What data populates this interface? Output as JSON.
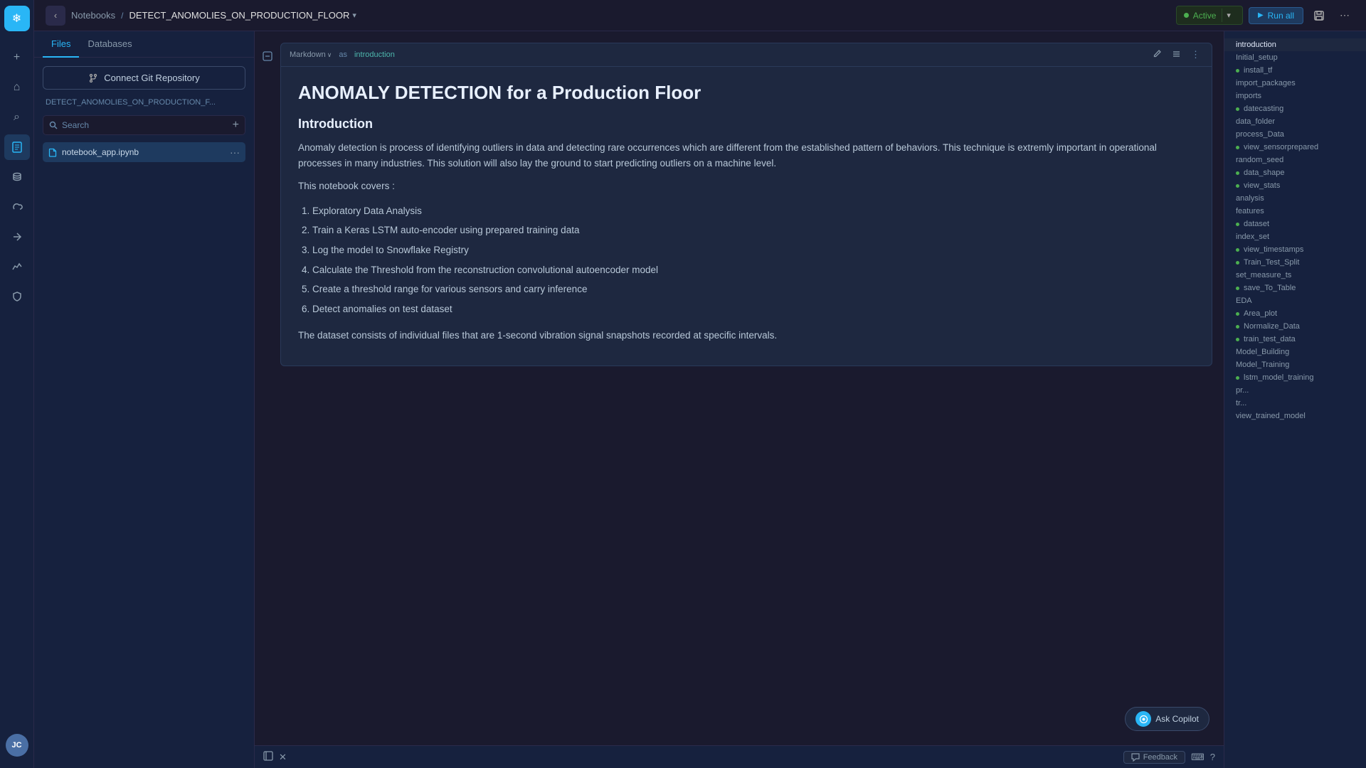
{
  "app": {
    "logo_initials": "❄",
    "title": "DETECT_ANOMOLIES_ON_PRODUCTION_FLOOR",
    "breadcrumb": "Notebooks",
    "title_dropdown": "▾"
  },
  "topbar": {
    "back_label": "‹",
    "status": "Active",
    "status_chevron": "▾",
    "run_all": "Run all",
    "save_icon": "💾",
    "more_icon": "⋯"
  },
  "file_panel": {
    "tabs": [
      "Files",
      "Databases"
    ],
    "active_tab": "Files",
    "connect_git": "Connect Git Repository",
    "notebook_label": "DETECT_ANOMOLIES_ON_PRODUCTION_F...",
    "search_placeholder": "Search",
    "add_icon": "+",
    "file_name": "notebook_app.ipynb",
    "file_dots": "···"
  },
  "cell": {
    "type": "Markdown",
    "type_chevron": "∨",
    "as_label": "as",
    "cell_name": "introduction",
    "edit_icon": "✏",
    "list_icon": "☰",
    "more_icon": "⋮"
  },
  "content": {
    "heading": "ANOMALY DETECTION for a Production Floor",
    "intro_heading": "Introduction",
    "intro_body": "Anomaly detection is process of identifying outliers in data and detecting rare occurrences which are different from the established pattern of behaviors. This technique is extremly important in operational processes in many industries. This solution will also lay the ground to start predicting outliers on a machine level.",
    "covers_label": "This notebook covers :",
    "list_items": [
      "Exploratory Data Analysis",
      "Train a Keras LSTM auto-encoder using prepared training data",
      "Log the model to Snowflake Registry",
      "Calculate the Threshold from the reconstruction convolutional autoencoder model",
      "Create a threshold range for various sensors and carry inference",
      "Detect anomalies on test dataset"
    ],
    "footer_text": "The dataset consists of individual files that are 1-second vibration signal snapshots recorded at specific intervals."
  },
  "outline": {
    "items": [
      {
        "name": "introduction",
        "type": "active"
      },
      {
        "name": "Initial_setup",
        "type": "plain"
      },
      {
        "name": "install_tf",
        "type": "dot"
      },
      {
        "name": "import_packages",
        "type": "plain"
      },
      {
        "name": "imports",
        "type": "plain"
      },
      {
        "name": "datecasting",
        "type": "dot"
      },
      {
        "name": "data_folder",
        "type": "plain"
      },
      {
        "name": "process_Data",
        "type": "plain"
      },
      {
        "name": "view_sensorprepared",
        "type": "dot"
      },
      {
        "name": "random_seed",
        "type": "plain"
      },
      {
        "name": "data_shape",
        "type": "dot"
      },
      {
        "name": "view_stats",
        "type": "dot"
      },
      {
        "name": "analysis",
        "type": "plain"
      },
      {
        "name": "features",
        "type": "plain"
      },
      {
        "name": "dataset",
        "type": "dot"
      },
      {
        "name": "index_set",
        "type": "plain"
      },
      {
        "name": "view_timestamps",
        "type": "dot"
      },
      {
        "name": "Train_Test_Split",
        "type": "dot"
      },
      {
        "name": "set_measure_ts",
        "type": "plain"
      },
      {
        "name": "save_To_Table",
        "type": "dot"
      },
      {
        "name": "EDA",
        "type": "plain"
      },
      {
        "name": "Area_plot",
        "type": "dot"
      },
      {
        "name": "Normalize_Data",
        "type": "dot"
      },
      {
        "name": "train_test_data",
        "type": "dot"
      },
      {
        "name": "Model_Building",
        "type": "plain"
      },
      {
        "name": "Model_Training",
        "type": "plain"
      },
      {
        "name": "lstm_model_training",
        "type": "dot"
      },
      {
        "name": "pr...",
        "type": "plain"
      },
      {
        "name": "tr...",
        "type": "plain"
      },
      {
        "name": "view_trained_model",
        "type": "plain"
      }
    ]
  },
  "bottom": {
    "copilot_label": "Ask Copilot",
    "feedback_label": "Feedback",
    "keyboard_icon": "⌨",
    "help_icon": "?"
  },
  "sidebar_icons": [
    {
      "name": "home-icon",
      "symbol": "⌂",
      "active": false
    },
    {
      "name": "search-icon",
      "symbol": "⌕",
      "active": false
    },
    {
      "name": "notebooks-icon",
      "symbol": "📓",
      "active": true
    },
    {
      "name": "database-icon",
      "symbol": "🗄",
      "active": false
    },
    {
      "name": "cloud-icon",
      "symbol": "☁",
      "active": false
    },
    {
      "name": "transform-icon",
      "symbol": "⚡",
      "active": false
    },
    {
      "name": "monitor-icon",
      "symbol": "📈",
      "active": false
    },
    {
      "name": "shield-icon",
      "symbol": "🛡",
      "active": false
    }
  ]
}
